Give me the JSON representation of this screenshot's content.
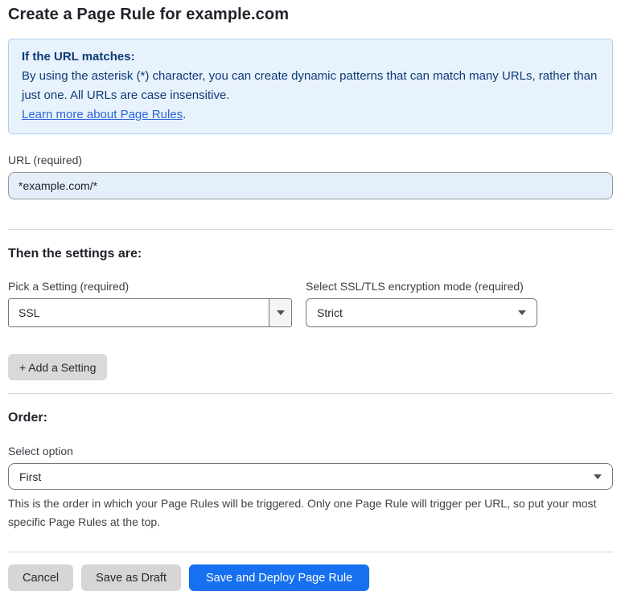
{
  "page": {
    "title": "Create a Page Rule for example.com"
  },
  "info_box": {
    "heading": "If the URL matches:",
    "body": "By using the asterisk (*) character, you can create dynamic patterns that can match many URLs, rather than just one. All URLs are case insensitive.",
    "link": "Learn more about Page Rules",
    "link_suffix": "."
  },
  "url_field": {
    "label": "URL (required)",
    "value": "*example.com/*"
  },
  "settings": {
    "heading": "Then the settings are:",
    "pick_setting": {
      "label": "Pick a Setting (required)",
      "value": "SSL"
    },
    "ssl_mode": {
      "label": "Select SSL/TLS encryption mode (required)",
      "value": "Strict"
    },
    "add_button_label": "+ Add a Setting"
  },
  "order": {
    "heading": "Order:",
    "label": "Select option",
    "value": "First",
    "help": "This is the order in which your Page Rules will be triggered. Only one Page Rule will trigger per URL, so put your most specific Page Rules at the top."
  },
  "footer": {
    "cancel_label": "Cancel",
    "save_draft_label": "Save as Draft",
    "save_deploy_label": "Save and Deploy Page Rule"
  },
  "colors": {
    "primary_button_blue": "#1670f0",
    "info_box_background": "#e8f2fc",
    "info_box_border": "#aacdef",
    "info_box_text": "#0e3a78",
    "link_blue": "#2c64d9",
    "url_input_background": "#e5effc"
  }
}
